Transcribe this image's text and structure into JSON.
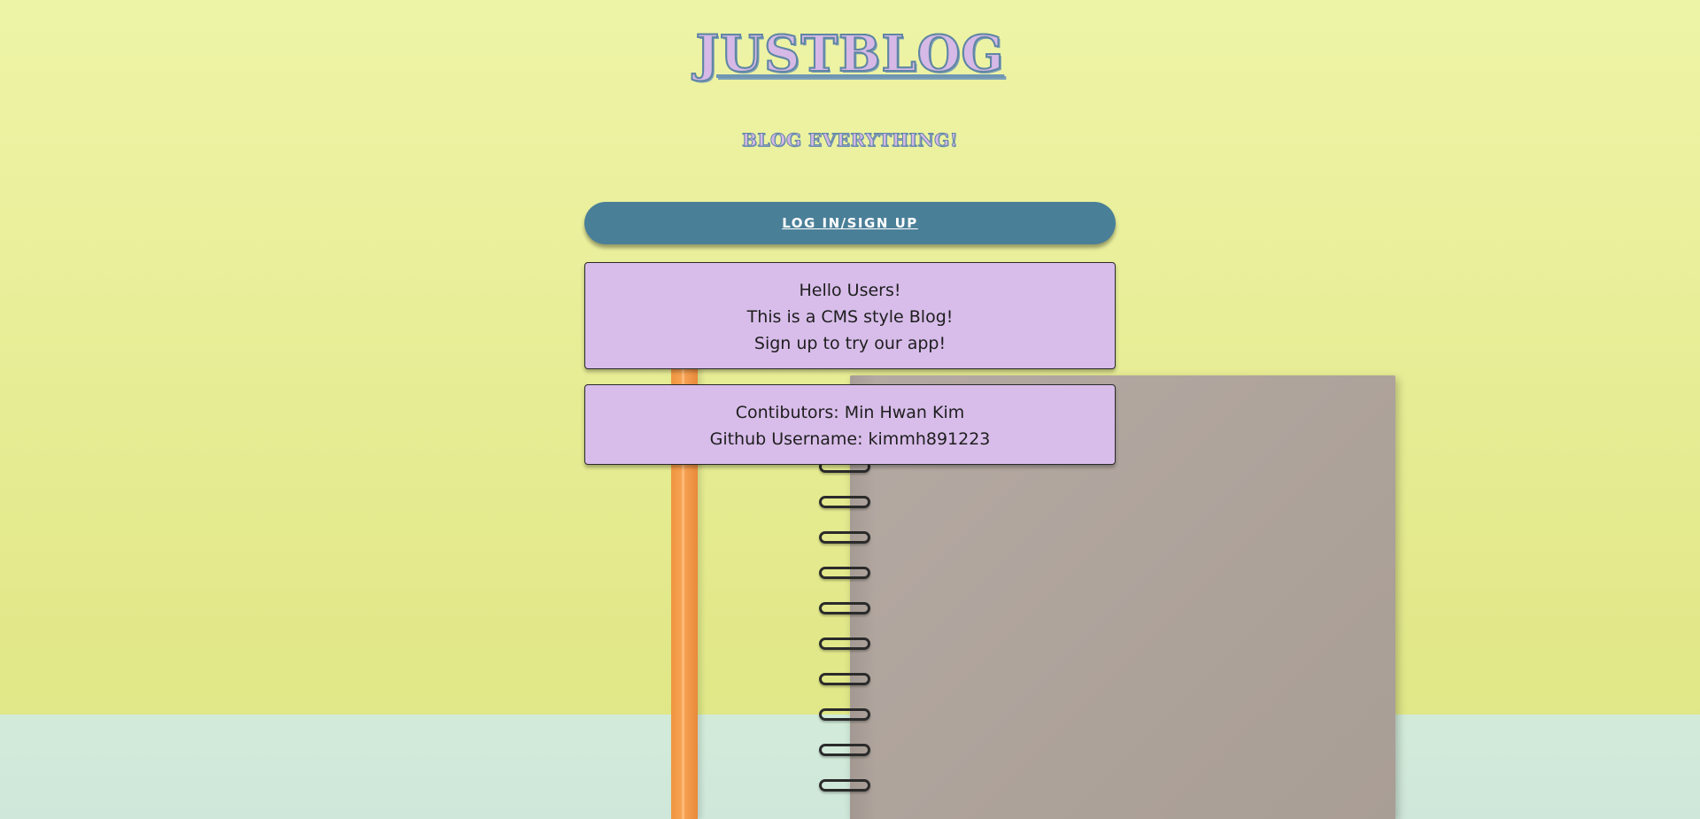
{
  "header": {
    "title": "JUSTBLOG",
    "subtitle": "BLOG EVERYTHING!"
  },
  "actions": {
    "login_label": "LOG IN/SIGN UP"
  },
  "intro_card": {
    "lines": [
      "Hello Users!",
      "This is a CMS style Blog!",
      "Sign up to try our app!"
    ]
  },
  "contributors_card": {
    "lines": [
      "Contibutors: Min Hwan Kim",
      "Github Username: kimmh891223"
    ]
  },
  "colors": {
    "background": "#e9ee9b",
    "button": "#4a7f98",
    "card": "#d8bdea",
    "title_fill": "#d6b9e6",
    "title_outline": "#5f86a4"
  }
}
